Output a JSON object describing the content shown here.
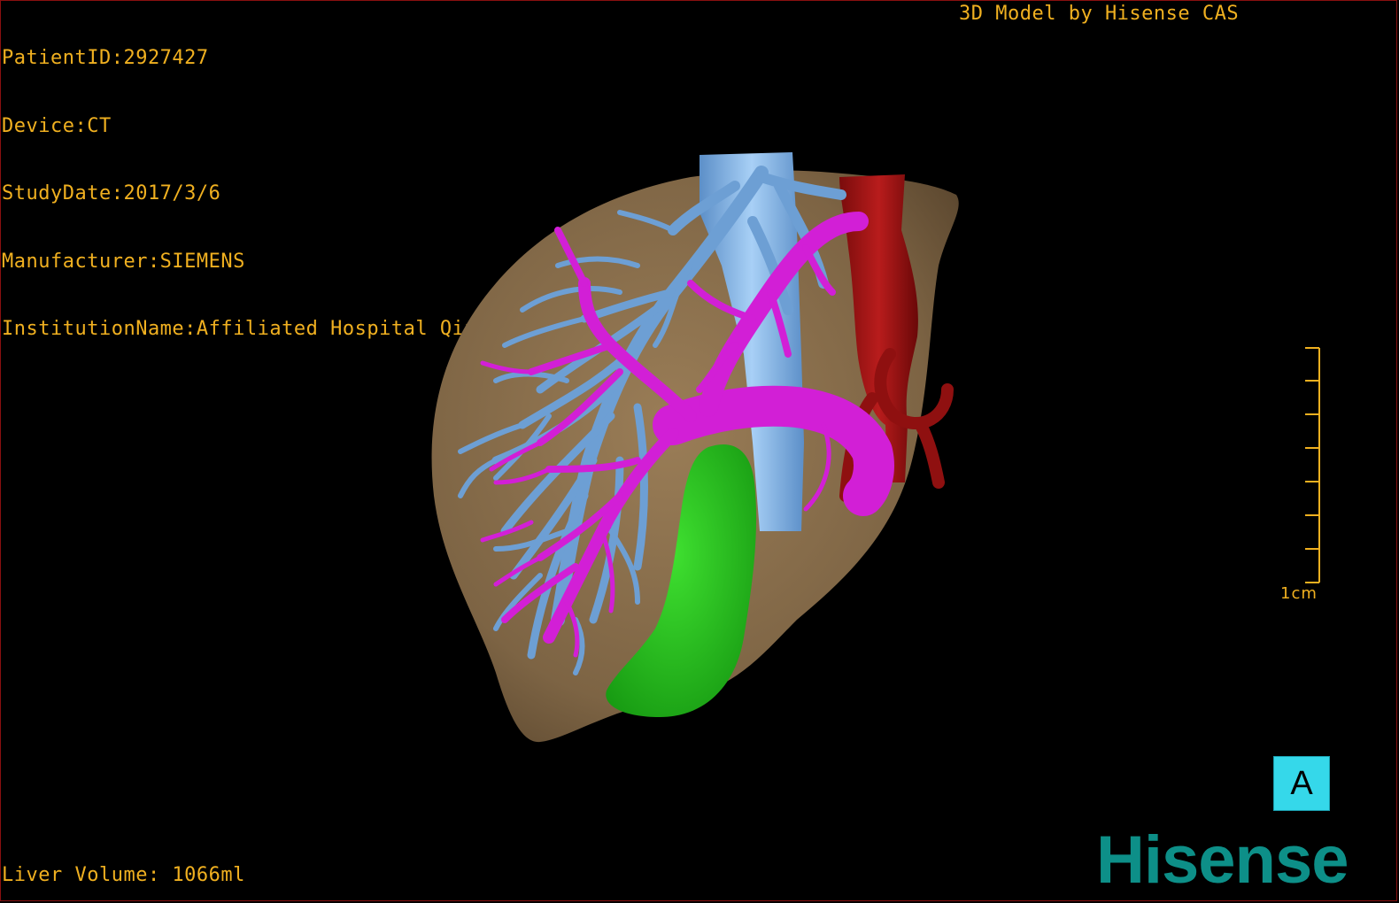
{
  "header": {
    "patient_id": "PatientID:2927427",
    "device": "Device:CT",
    "study_date": "StudyDate:2017/3/6",
    "manufacturer": "Manufacturer:SIEMENS",
    "institution": "InstitutionName:Affiliated Hospital Qingdao University-C"
  },
  "credit": "3D Model by Hisense CAS",
  "footer": {
    "liver_volume": "Liver Volume: 1066ml"
  },
  "scale_bar": {
    "label": "1cm"
  },
  "view_badge": "A",
  "logo": "Hisense",
  "colors": {
    "text": "#f0b020",
    "liver": "#8a6f4e",
    "hepatic_vein": "#6d9fd4",
    "portal_vein": "#d21fd6",
    "artery": "#a31414",
    "gallbladder": "#2bc21f",
    "badge": "#35d8ea",
    "logo": "#0d8f88"
  }
}
